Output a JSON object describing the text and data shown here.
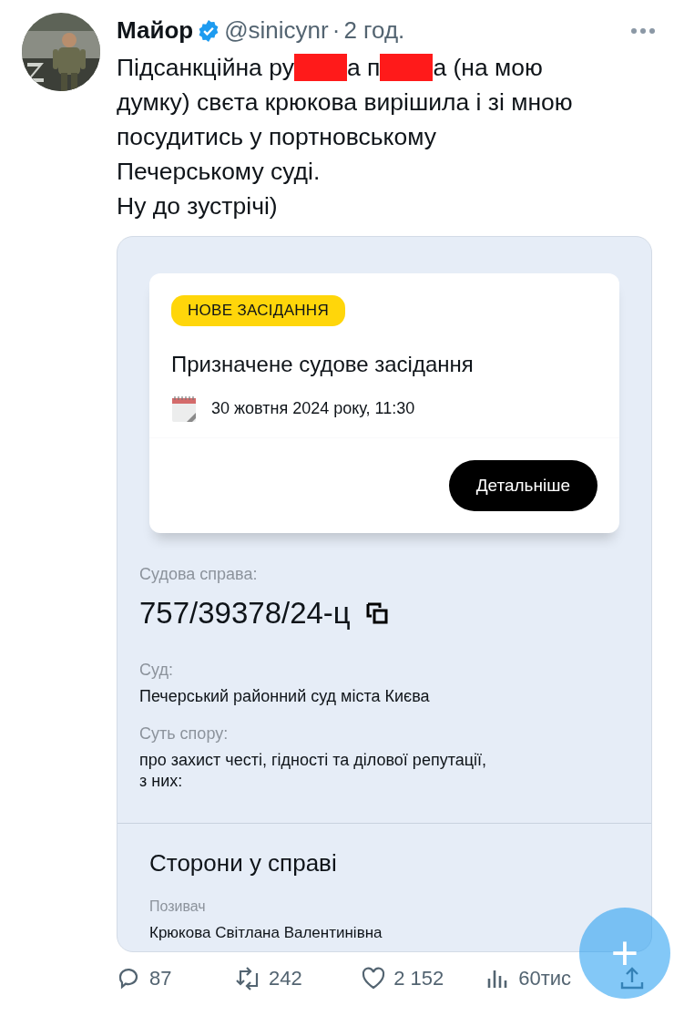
{
  "post": {
    "author": {
      "name": "Майор",
      "verified": true,
      "handle": "@sinicynr",
      "separator": "·",
      "time": "2 год."
    },
    "text": [
      {
        "kind": "text",
        "text": "Підсанкційна ру"
      },
      {
        "kind": "redaction"
      },
      {
        "kind": "text",
        "text": "а п"
      },
      {
        "kind": "redaction"
      },
      {
        "kind": "text",
        "text": "а (на мою\nдумку) свєта крюкова вирішила і зі мною\nпосудитись у портновському\nПечерському суді.\nНу до зустрічі)"
      }
    ],
    "attachment": {
      "notice": {
        "badge": "НОВЕ ЗАСІДАННЯ",
        "title": "Призначене судове засідання",
        "date": "30 жовтня 2024 року, 11:30",
        "button": "Детальніше"
      },
      "fields": [
        {
          "kind": "case",
          "label": "Судова справа:",
          "value": "757/39378/24-ц"
        },
        {
          "kind": "text",
          "label": "Суд:",
          "value": "Печерський районний суд міста Києва"
        },
        {
          "kind": "text",
          "label": "Суть спору:",
          "value": "про захист честі, гідності та ділової репутації,\nз них:"
        }
      ],
      "parties": {
        "title": "Сторони у справі",
        "items": [
          {
            "role": "Позивач",
            "name": "Крюкова Світлана Валентинівна"
          }
        ]
      }
    },
    "actions": [
      {
        "kind": "reply",
        "count": "87"
      },
      {
        "kind": "repost",
        "count": "242"
      },
      {
        "kind": "like",
        "count": "2 152"
      },
      {
        "kind": "views",
        "count": "60тис"
      },
      {
        "kind": "share"
      }
    ]
  },
  "compose_button": {
    "label": "+"
  }
}
